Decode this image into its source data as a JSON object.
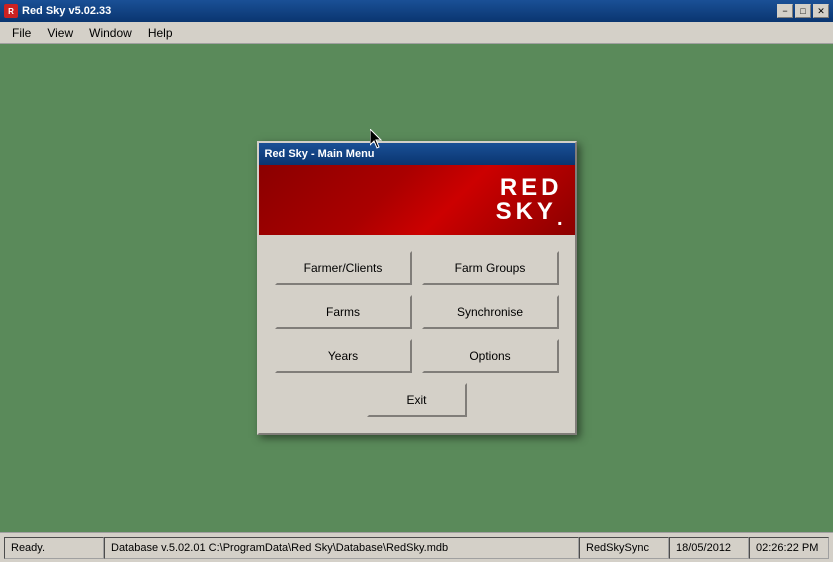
{
  "titlebar": {
    "icon": "R",
    "title": "Red Sky v5.02.33",
    "minimize": "−",
    "maximize": "□",
    "close": "✕"
  },
  "menubar": {
    "items": [
      {
        "label": "File"
      },
      {
        "label": "View"
      },
      {
        "label": "Window"
      },
      {
        "label": "Help"
      }
    ]
  },
  "dialog": {
    "title": "Red Sky - Main Menu",
    "logo_line1": "RED",
    "logo_line2": "SKY",
    "logo_dot": ".",
    "buttons": {
      "farmer_clients": "Farmer/Clients",
      "farm_groups": "Farm Groups",
      "farms": "Farms",
      "synchronise": "Synchronise",
      "years": "Years",
      "options": "Options",
      "exit": "Exit"
    }
  },
  "statusbar": {
    "ready": "Ready.",
    "database": "Database v.5.02.01 C:\\ProgramData\\Red Sky\\Database\\RedSky.mdb",
    "sync": "RedSkySync",
    "date": "18/05/2012",
    "time": "02:26:22 PM"
  }
}
